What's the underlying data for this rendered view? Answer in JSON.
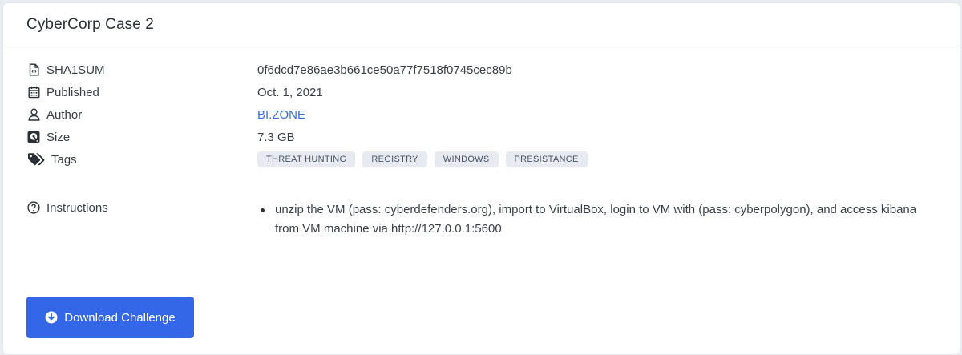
{
  "card": {
    "title": "CyberCorp Case 2"
  },
  "meta": {
    "sha1": {
      "label": "SHA1SUM",
      "value": "0f6dcd7e86ae3b661ce50a77f7518f0745cec89b",
      "icon": "file-code-icon"
    },
    "published": {
      "label": "Published",
      "value": "Oct. 1, 2021",
      "icon": "calendar-icon"
    },
    "author": {
      "label": "Author",
      "value": "BI.ZONE",
      "icon": "user-icon"
    },
    "size": {
      "label": "Size",
      "value": "7.3 GB",
      "icon": "hard-drive-icon"
    },
    "tags": {
      "label": "Tags",
      "icon": "tags-icon",
      "items": [
        "THREAT HUNTING",
        "REGISTRY",
        "WINDOWS",
        "PRESISTANCE"
      ]
    }
  },
  "instructions": {
    "label": "Instructions",
    "icon": "question-circle-icon",
    "items": [
      "unzip the VM (pass: cyberdefenders.org), import to VirtualBox, login to VM with (pass: cyberpolygon), and access kibana from VM machine via http://127.0.0.1:5600"
    ]
  },
  "download": {
    "label": "Download Challenge",
    "icon": "download-circle-icon"
  },
  "colors": {
    "accent": "#3467e8",
    "link": "#3b6fd8",
    "tag_bg": "#e7ebf1",
    "page_bg": "#e9edf2"
  }
}
